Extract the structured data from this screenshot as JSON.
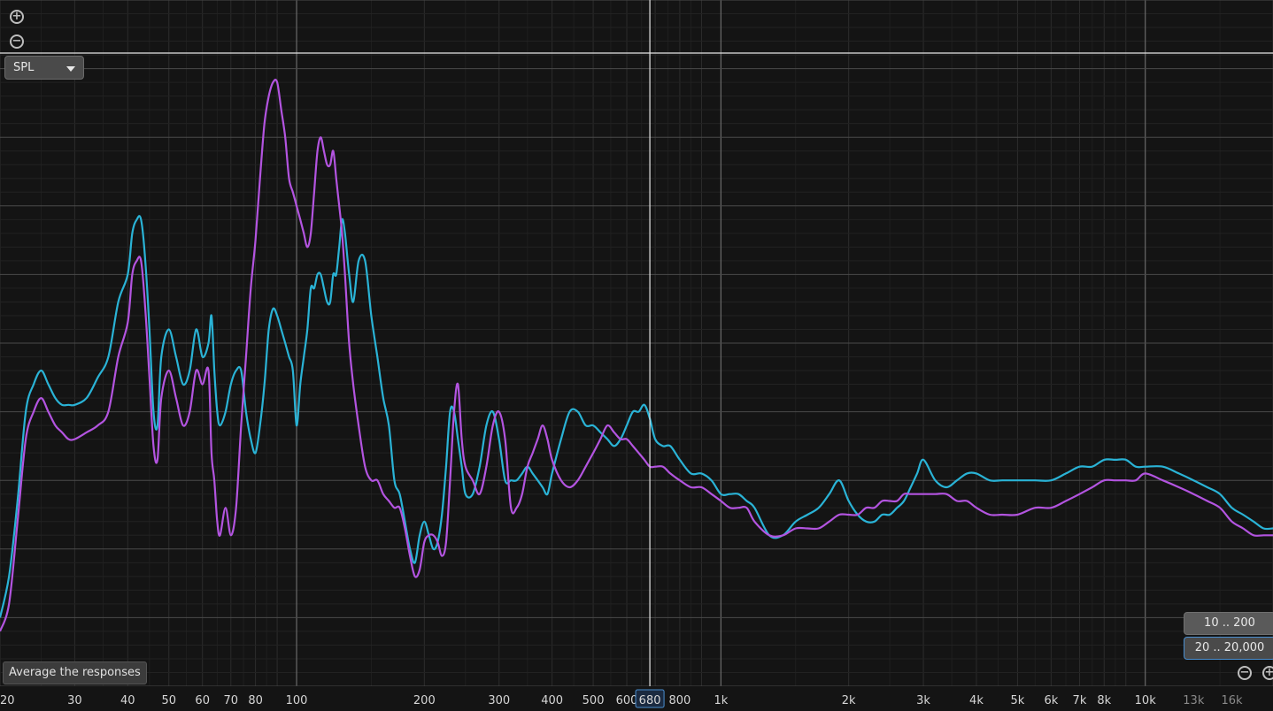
{
  "controls": {
    "zoom_in_icon": "zoom-in-icon",
    "zoom_out_icon": "zoom-out-icon",
    "measure_select": "SPL",
    "average_button": "Average the responses",
    "range_preset_1": "10 .. 200",
    "range_preset_2": "20 .. 20,000"
  },
  "chart_data": {
    "type": "line",
    "x_scale": "log",
    "xlim": [
      20,
      20000
    ],
    "ylim": [
      0,
      100
    ],
    "grid": true,
    "cursor_x": 680,
    "cursor_x_label": "680",
    "major_tick_labels": [
      {
        "v": 20,
        "t": "20"
      },
      {
        "v": 30,
        "t": "30"
      },
      {
        "v": 40,
        "t": "40"
      },
      {
        "v": 50,
        "t": "50"
      },
      {
        "v": 60,
        "t": "60"
      },
      {
        "v": 70,
        "t": "70"
      },
      {
        "v": 80,
        "t": "80"
      },
      {
        "v": 100,
        "t": "100"
      },
      {
        "v": 200,
        "t": "200"
      },
      {
        "v": 300,
        "t": "300"
      },
      {
        "v": 400,
        "t": "400"
      },
      {
        "v": 500,
        "t": "500"
      },
      {
        "v": 600,
        "t": "600"
      },
      {
        "v": 800,
        "t": "800"
      },
      {
        "v": 1000,
        "t": "1k"
      },
      {
        "v": 2000,
        "t": "2k"
      },
      {
        "v": 3000,
        "t": "3k"
      },
      {
        "v": 4000,
        "t": "4k"
      },
      {
        "v": 5000,
        "t": "5k"
      },
      {
        "v": 6000,
        "t": "6k"
      },
      {
        "v": 7000,
        "t": "7k"
      },
      {
        "v": 8000,
        "t": "8k"
      },
      {
        "v": 10000,
        "t": "10k"
      }
    ],
    "minor_tick_labels": [
      {
        "v": 13000,
        "t": "13k"
      },
      {
        "v": 16000,
        "t": "16k"
      }
    ],
    "series": [
      {
        "color": "#2ab3d6",
        "x": [
          20,
          21,
          22,
          23,
          24,
          25,
          26,
          27,
          28,
          29,
          30,
          32,
          34,
          36,
          38,
          40,
          41,
          42,
          43,
          44,
          45,
          46,
          47,
          48,
          50,
          52,
          54,
          56,
          58,
          60,
          62,
          63,
          64,
          65,
          66,
          68,
          70,
          72,
          74,
          76,
          78,
          80,
          82,
          84,
          86,
          88,
          90,
          92,
          94,
          96,
          98,
          100,
          102,
          104,
          106,
          108,
          110,
          112,
          114,
          116,
          118,
          120,
          122,
          124,
          126,
          128,
          130,
          133,
          136,
          140,
          145,
          150,
          155,
          160,
          165,
          170,
          175,
          180,
          185,
          190,
          195,
          200,
          205,
          210,
          215,
          220,
          225,
          230,
          235,
          240,
          245,
          250,
          260,
          270,
          280,
          290,
          300,
          310,
          320,
          330,
          340,
          350,
          360,
          370,
          380,
          390,
          400,
          420,
          440,
          460,
          480,
          500,
          520,
          540,
          560,
          580,
          600,
          620,
          640,
          660,
          680,
          700,
          730,
          760,
          800,
          850,
          900,
          950,
          1000,
          1050,
          1100,
          1150,
          1200,
          1300,
          1400,
          1500,
          1600,
          1700,
          1800,
          1900,
          2000,
          2100,
          2200,
          2300,
          2400,
          2500,
          2600,
          2700,
          2800,
          2900,
          3000,
          3200,
          3400,
          3600,
          3800,
          4000,
          4300,
          4600,
          5000,
          5500,
          6000,
          6500,
          7000,
          7500,
          8000,
          8500,
          9000,
          9500,
          10000,
          11000,
          12000,
          13000,
          14000,
          15000,
          16000,
          17000,
          18000,
          19000,
          20000
        ],
        "y": [
          10,
          16,
          27,
          40,
          44,
          46,
          44,
          42,
          41,
          41,
          41,
          42,
          45,
          48,
          56,
          60,
          66,
          68,
          68,
          62,
          52,
          40,
          38,
          48,
          52,
          48,
          44,
          46,
          52,
          48,
          50,
          54,
          46,
          40,
          38,
          40,
          44,
          46,
          46,
          40,
          36,
          34,
          38,
          44,
          52,
          55,
          54,
          52,
          50,
          48,
          46,
          38,
          44,
          48,
          52,
          58,
          58,
          60,
          60,
          58,
          56,
          56,
          60,
          60,
          64,
          68,
          66,
          60,
          56,
          62,
          62,
          54,
          48,
          42,
          38,
          30,
          28,
          24,
          20,
          18,
          22,
          24,
          22,
          20,
          21,
          25,
          32,
          40,
          40,
          36,
          32,
          28,
          28,
          32,
          38,
          40,
          36,
          30,
          30,
          30,
          31,
          32,
          31,
          30,
          29,
          28,
          31,
          36,
          40,
          40,
          38,
          38,
          37,
          36,
          35,
          36,
          38,
          40,
          40,
          41,
          39,
          36,
          35,
          35,
          33,
          31,
          31,
          30,
          28,
          28,
          28,
          27,
          26,
          22,
          22,
          24,
          25,
          26,
          28,
          30,
          27,
          25,
          24,
          24,
          25,
          25,
          26,
          27,
          29,
          31,
          33,
          30,
          29,
          30,
          31,
          31,
          30,
          30,
          30,
          30,
          30,
          31,
          32,
          32,
          33,
          33,
          33,
          32,
          32,
          32,
          31,
          30,
          29,
          28,
          26,
          25,
          24,
          23,
          23
        ]
      },
      {
        "color": "#b354e0",
        "x": [
          20,
          21,
          22,
          23,
          24,
          25,
          26,
          27,
          28,
          29,
          30,
          32,
          34,
          36,
          38,
          40,
          41,
          42,
          43,
          44,
          45,
          46,
          47,
          48,
          50,
          52,
          54,
          56,
          58,
          60,
          62,
          63,
          64,
          65,
          66,
          68,
          70,
          72,
          74,
          76,
          78,
          80,
          82,
          84,
          86,
          88,
          90,
          92,
          94,
          96,
          98,
          100,
          102,
          104,
          106,
          108,
          110,
          112,
          114,
          116,
          118,
          120,
          122,
          124,
          126,
          128,
          130,
          133,
          136,
          140,
          145,
          150,
          155,
          160,
          165,
          170,
          175,
          180,
          185,
          190,
          195,
          200,
          205,
          210,
          215,
          220,
          225,
          230,
          235,
          240,
          245,
          250,
          260,
          270,
          280,
          290,
          300,
          310,
          320,
          330,
          340,
          350,
          360,
          370,
          380,
          390,
          400,
          420,
          440,
          460,
          480,
          500,
          520,
          540,
          560,
          580,
          600,
          620,
          640,
          660,
          680,
          700,
          730,
          760,
          800,
          850,
          900,
          950,
          1000,
          1050,
          1100,
          1150,
          1200,
          1300,
          1400,
          1500,
          1600,
          1700,
          1800,
          1900,
          2000,
          2100,
          2200,
          2300,
          2400,
          2500,
          2600,
          2700,
          2800,
          2900,
          3000,
          3200,
          3400,
          3600,
          3800,
          4000,
          4300,
          4600,
          5000,
          5500,
          6000,
          6500,
          7000,
          7500,
          8000,
          8500,
          9000,
          9500,
          10000,
          11000,
          12000,
          13000,
          14000,
          15000,
          16000,
          17000,
          18000,
          19000,
          20000
        ],
        "y": [
          8,
          12,
          24,
          36,
          40,
          42,
          40,
          38,
          37,
          36,
          36,
          37,
          38,
          40,
          48,
          53,
          60,
          62,
          62,
          55,
          45,
          35,
          33,
          42,
          46,
          42,
          38,
          40,
          46,
          44,
          46,
          34,
          30,
          24,
          22,
          26,
          22,
          26,
          38,
          48,
          58,
          65,
          74,
          82,
          86,
          88,
          88,
          84,
          80,
          74,
          72,
          70,
          68,
          66,
          64,
          66,
          72,
          78,
          80,
          78,
          76,
          76,
          78,
          74,
          70,
          66,
          60,
          50,
          44,
          38,
          32,
          30,
          30,
          28,
          27,
          26,
          26,
          23,
          19,
          16,
          17,
          21,
          22,
          22,
          21,
          19,
          21,
          30,
          40,
          44,
          36,
          32,
          30,
          28,
          32,
          38,
          40,
          36,
          26,
          26,
          28,
          32,
          34,
          36,
          38,
          36,
          33,
          30,
          29,
          30,
          32,
          34,
          36,
          38,
          37,
          36,
          36,
          35,
          34,
          33,
          32,
          32,
          32,
          31,
          30,
          29,
          29,
          28,
          27,
          26,
          26,
          26,
          24,
          22,
          22,
          23,
          23,
          23,
          24,
          25,
          25,
          25,
          26,
          26,
          27,
          27,
          27,
          28,
          28,
          28,
          28,
          28,
          28,
          27,
          27,
          26,
          25,
          25,
          25,
          26,
          26,
          27,
          28,
          29,
          30,
          30,
          30,
          30,
          31,
          30,
          29,
          28,
          27,
          26,
          24,
          23,
          22,
          22,
          22
        ]
      }
    ]
  }
}
